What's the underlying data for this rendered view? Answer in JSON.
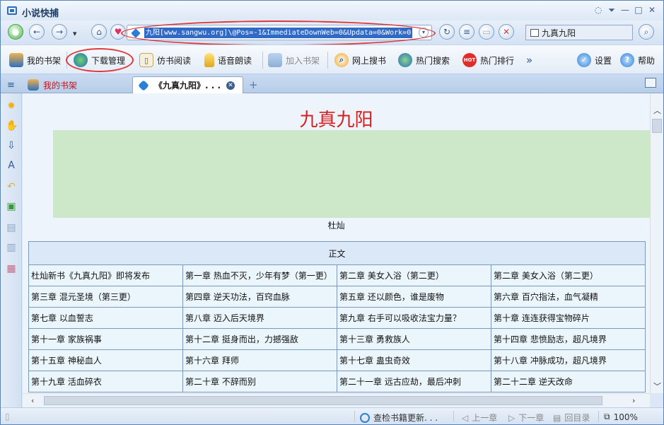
{
  "window": {
    "title": "小说快捕",
    "controls": [
      "chat-icon",
      "minimize-down-icon",
      "minimize-icon",
      "maximize-icon",
      "close-icon"
    ]
  },
  "navbar": {
    "address": "九阳[www.sangwu.org]\\@Pos=-1&ImmediateDownWeb=0&Updata=0&Work=0",
    "search_value": "九真九阳"
  },
  "toolbar": {
    "my_bookshelf": "我的书架",
    "download_manager": "下载管理",
    "book_reading": "仿书阅读",
    "voice_reading": "语音朗读",
    "add_to_shelf": "加入书架",
    "web_search": "网上搜书",
    "hot_search": "热门搜索",
    "hot_rank": "热门排行",
    "more": "»",
    "settings": "设置",
    "help": "帮助",
    "hot_badge": "HOT"
  },
  "tabs": {
    "bookshelf": "我的书架",
    "book": "《九真九阳》. . ."
  },
  "content": {
    "book_title": "九真九阳",
    "author": "杜灿",
    "toc_header": "正文",
    "chapters": [
      [
        "杜灿新书《九真九阳》即将发布",
        "第一章 热血不灭，少年有梦（第一更）",
        "第二章 美女入浴（第二更）",
        "第二章 美女入浴（第二更）"
      ],
      [
        "第三章 混元圣境（第三更）",
        "第四章 逆天功法，百窍血脉",
        "第五章 还以颜色，谁是废物",
        "第六章 百穴指法，血气凝精"
      ],
      [
        "第七章 以血誓志",
        "第八章 迈入后天境界",
        "第九章 右手可以吸收法宝力量？",
        "第十章 连连获得宝物碎片"
      ],
      [
        "第十一章 家族祸事",
        "第十二章 挺身而出，力撼强敌",
        "第十三章 勇救族人",
        "第十四章 悲愤励志，超凡境界"
      ],
      [
        "第十五章 神秘血人",
        "第十六章 拜师",
        "第十七章 蛊虫奇效",
        "第十八章 冲脉成功，超凡境界"
      ],
      [
        "第十九章 活血碎衣",
        "第二十章 不辞而别",
        "第二十一章 远古应劫，最后冲刺",
        "第二十二章 逆天改命"
      ]
    ]
  },
  "statusbar": {
    "check_updates": "查检书籍更新. . .",
    "prev_chapter": "上一章",
    "next_chapter": "下一章",
    "back_to_toc": "回目录",
    "zoom": "100%"
  },
  "colors": {
    "title_red": "#d62020",
    "highlight_ellipse": "#e0383b",
    "selection_blue": "#3169c6",
    "green_area": "#cde8c9"
  }
}
